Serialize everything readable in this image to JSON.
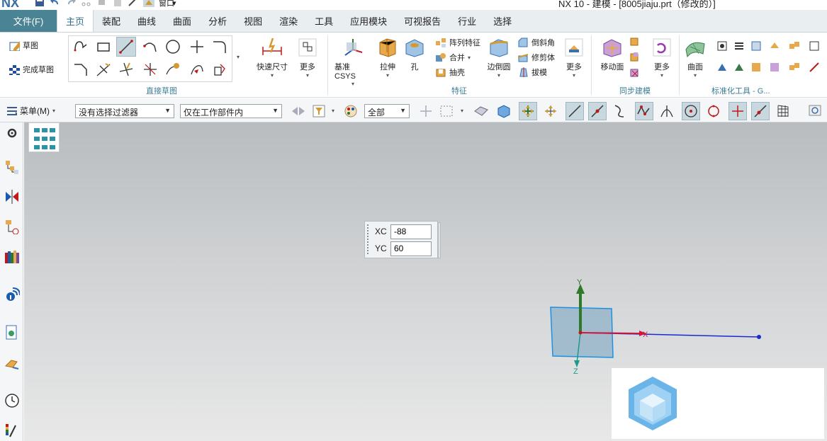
{
  "titlebar": {
    "logo": "NX",
    "title": "NX 10 - 建模 - [8005jiaju.prt（修改的）]",
    "window_menu": "窗口"
  },
  "tabs": {
    "file": "文件(F)",
    "items": [
      "主页",
      "装配",
      "曲线",
      "曲面",
      "分析",
      "视图",
      "渲染",
      "工具",
      "应用模块",
      "可视报告",
      "行业",
      "选择"
    ],
    "active_index": 0
  },
  "ribbon": {
    "sketch_group": {
      "sketch": "草图",
      "finish_sketch": "完成草图",
      "label": "直接草图",
      "quick_dim": "快速尺寸",
      "more": "更多"
    },
    "feature_group": {
      "datum_csys": "基准 CSYS",
      "extrude": "拉伸",
      "hole": "孔",
      "pattern": "阵列特征",
      "unite": "合并",
      "shell": "抽壳",
      "edge_blend": "边倒圆",
      "chamfer": "倒斜角",
      "trim_body": "修剪体",
      "draft": "拔模",
      "more": "更多",
      "label": "特征"
    },
    "sync_group": {
      "move_face": "移动面",
      "more": "更多",
      "label": "同步建模"
    },
    "surface_group": {
      "surface": "曲面",
      "label": "标准化工具 - G..."
    }
  },
  "selection_bar": {
    "menu": "菜单(M)",
    "filter": "没有选择过滤器",
    "scope": "仅在工作部件内",
    "level": "全部"
  },
  "coord_input": {
    "xc_label": "XC",
    "xc_value": "-88",
    "yc_label": "YC",
    "yc_value": "60"
  },
  "csys": {
    "x_label": "X",
    "y_label": "Y",
    "z_label": "Z"
  },
  "colors": {
    "accent": "#4a8494",
    "tab_active_text": "#2f6e8c",
    "axis_x": "#d0183c",
    "axis_y": "#2f7a2a",
    "axis_z": "#1a9a8a",
    "sketch_plane": "#8fb1c8"
  }
}
